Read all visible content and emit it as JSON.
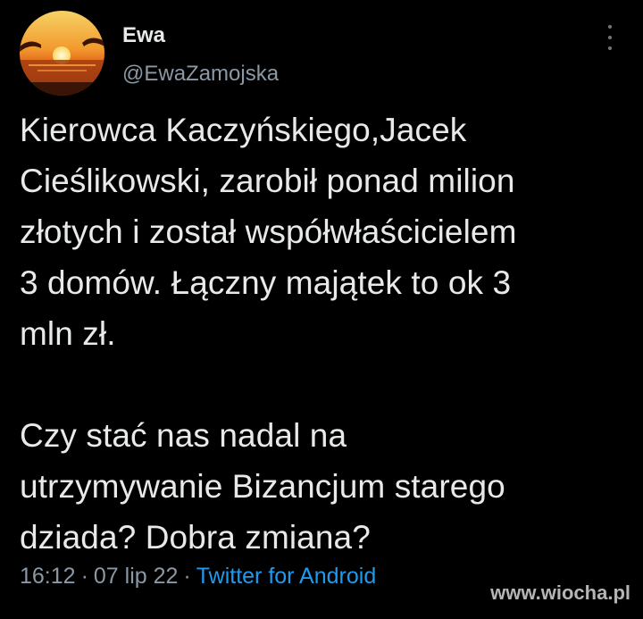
{
  "tweet": {
    "display_name": "Ewa",
    "handle": "@EwaZamojska",
    "more_icon": "more-vertical-icon",
    "text_lines": [
      "Kierowca Kaczyńskiego,Jacek",
      "Cieślikowski, zarobił ponad milion",
      "złotych i został współwłaścicielem",
      "3 domów. Łączny majątek to ok 3",
      "mln zł.",
      "",
      "Czy stać nas nadal na",
      "utrzymywanie Bizancjum starego",
      "dziada? Dobra zmiana?"
    ],
    "time": "16:12",
    "date": "07 lip 22",
    "separator": "·",
    "source": "Twitter for Android"
  },
  "watermark": "www.wiocha.pl",
  "colors": {
    "background": "#000000",
    "text": "#e7e9ea",
    "secondary": "#8b98a5",
    "link": "#1d9bf0"
  }
}
